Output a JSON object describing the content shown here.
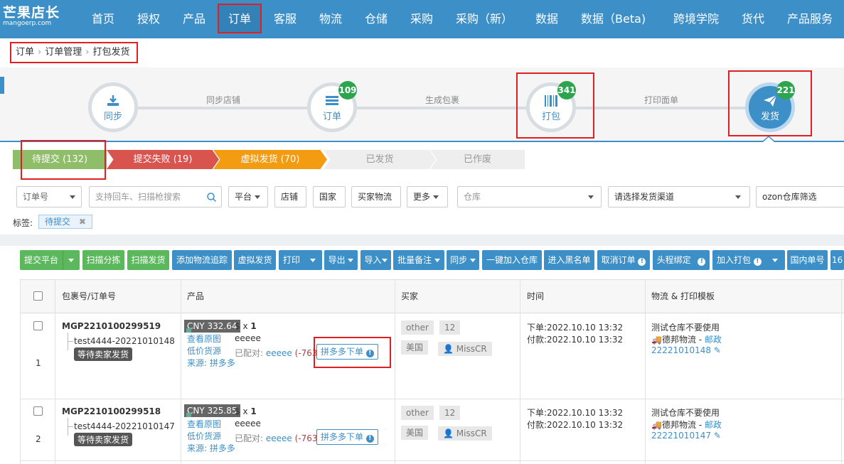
{
  "brand": {
    "name": "芒果店长",
    "domain": "mangoerp.com"
  },
  "nav": [
    "首页",
    "授权",
    "产品",
    "订单",
    "客服",
    "物流",
    "仓储",
    "采购",
    "采购（新）",
    "数据",
    "数据（Beta)",
    "跨境学院",
    "货代",
    "产品服务"
  ],
  "breadcrumb": [
    "订单",
    "订单管理",
    "打包发货"
  ],
  "flow": {
    "steps": [
      {
        "label": "同步",
        "icon": "download-icon"
      },
      {
        "label": "订单",
        "icon": "list-icon",
        "count": "109"
      },
      {
        "label": "打包",
        "icon": "barcode-icon",
        "count": "341"
      },
      {
        "label": "发货",
        "icon": "send-icon",
        "count": "221"
      }
    ],
    "links": [
      "同步店铺",
      "生成包裹",
      "打印面单"
    ]
  },
  "status_tabs": [
    {
      "label": "待提交 (132)",
      "color": "#8fbd6a"
    },
    {
      "label": "提交失败 (19)",
      "color": "#d9534f"
    },
    {
      "label": "虚拟发货 (70)",
      "color": "#f39c12"
    },
    {
      "label": "已发货",
      "color": "#eeeeee"
    },
    {
      "label": "已作废",
      "color": "#eeeeee"
    }
  ],
  "filters": {
    "order_no": "订单号",
    "search_placeholder": "支持回车、扫描枪搜索",
    "platform": "平台",
    "shop": "店铺",
    "country": "国家",
    "buyer_logistics": "买家物流",
    "more": "更多",
    "warehouse": "仓库",
    "channel": "请选择发货渠道",
    "ozon": "ozon仓库筛选"
  },
  "tags": {
    "label": "标签:",
    "value": "待提交"
  },
  "toolbar": [
    "提交平台",
    "扫描分拣",
    "扫描发货",
    "添加物流追踪",
    "虚拟发货",
    "打印",
    "导出",
    "导入",
    "批量备注",
    "同步",
    "一键加入仓库",
    "进入黑名单",
    "取消订单",
    "头程绑定",
    "加入打包",
    "国内单号",
    "16"
  ],
  "table": {
    "headers": [
      "包裹号/订单号",
      "产品",
      "买家",
      "时间",
      "物流 & 打印模板"
    ],
    "rows": [
      {
        "index": "1",
        "package": "MGP2210100299519",
        "order": "test4444-20221010148",
        "status": "等待卖家发货",
        "price": "CNY 332.64",
        "qty_prefix": "$ x ",
        "qty": "1",
        "product": "eeeee",
        "link1": "查看原图",
        "link2": "低价货源",
        "source": "来源: 拼多多",
        "matched_prefix": "已配对: ",
        "matched": "eeeee",
        "matched_num": "(-763)",
        "pdd_btn": "拼多多下单",
        "buyer_tag": "other",
        "buyer_num": "12",
        "country": "美国",
        "buyer": "MissCR",
        "order_time": "下单:2022.10.10 13:32",
        "pay_time": "付款:2022.10.10 13:32",
        "logistics_title": "测试仓库不要使用",
        "carrier": "德邦物流 - ",
        "carrier_link": "邮政",
        "tracking": "22221010148"
      },
      {
        "index": "2",
        "package": "MGP2210100299518",
        "order": "test4444-20221010147",
        "status": "等待卖家发货",
        "price": "CNY 325.85",
        "qty_prefix": "$ x ",
        "qty": "1",
        "product": "eeeee",
        "link1": "查看原图",
        "link2": "低价货源",
        "source": "来源: 拼多多",
        "matched_prefix": "已配对: ",
        "matched": "eeeee",
        "matched_num": "(-763)",
        "pdd_btn": "拼多多下单",
        "buyer_tag": "other",
        "buyer_num": "12",
        "country": "美国",
        "buyer": "MissCR",
        "order_time": "下单:2022.10.10 13:32",
        "pay_time": "付款:2022.10.10 13:32",
        "logistics_title": "测试仓库不要使用",
        "carrier": "德邦物流 - ",
        "carrier_link": "邮政",
        "tracking": "22221010147"
      }
    ]
  }
}
